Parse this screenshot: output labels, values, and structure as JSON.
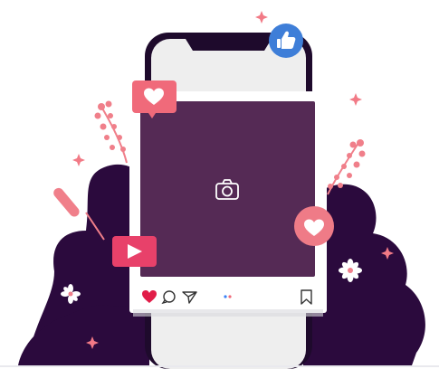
{
  "illustration": {
    "subject": "smartphone-social-media-post",
    "colors": {
      "dark_blob": "#2b0a3d",
      "phone_frame": "#1e0a2c",
      "phone_screen": "#eeeeee",
      "post_card": "#ffffff",
      "post_image": "#552a55",
      "camera_icon": "#ffffff",
      "like_badge": "#f06a7a",
      "heart_badge": "#ef7b87",
      "play_badge": "#e8416a",
      "thumbs_up_badge": "#3e7ed8",
      "heart_action": "#e11d48",
      "pagination_dot_active": "#3b82f6",
      "pagination_dot_inactive": "#f06a7a",
      "plant": "#f07f8a",
      "sparkle": "#f27a86",
      "ground_line": "#e9e9ee"
    },
    "icons": [
      "thumbs-up-icon",
      "heart-icon",
      "play-icon",
      "camera-icon",
      "comment-icon",
      "share-icon",
      "bookmark-icon",
      "sparkle-icon",
      "flower-icon",
      "plant-icon"
    ]
  }
}
